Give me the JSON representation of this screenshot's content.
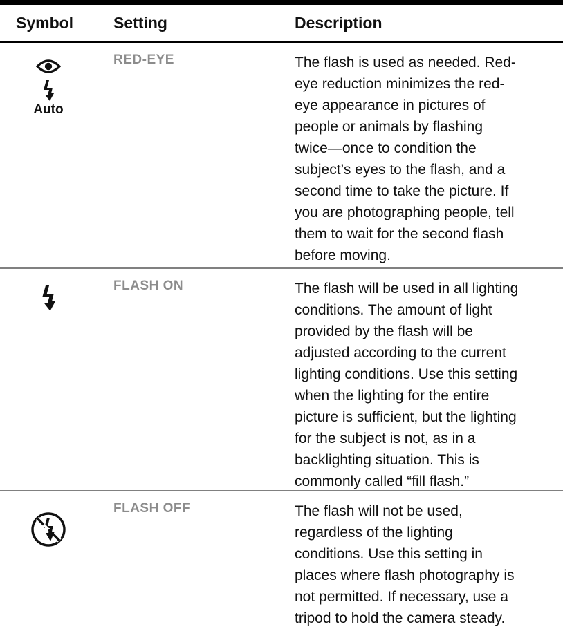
{
  "table": {
    "columns": [
      "Symbol",
      "Setting",
      "Description"
    ],
    "rows": [
      {
        "symbol_icons": [
          "eye-icon",
          "flash-icon"
        ],
        "symbol_label": "Auto",
        "setting": "RED-EYE",
        "description_lines": [
          "The flash is used as needed. Red-",
          "eye reduction minimizes the red-",
          "eye appearance in pictures of",
          "people or animals by flashing",
          "twice—once to condition the",
          "subject’s eyes to the flash, and a",
          "second time to take the picture. If",
          "you are photographing people, tell",
          "them to wait for the second flash",
          "before moving."
        ]
      },
      {
        "symbol_icons": [
          "flash-icon"
        ],
        "setting": "FLASH ON",
        "description_lines": [
          "The flash will be used in all lighting",
          "conditions. The amount of light",
          "provided by the flash will be",
          "adjusted according to the current",
          "lighting conditions. Use this setting",
          "when the lighting for the entire",
          "picture is sufficient, but the lighting",
          "for the subject is not, as in a",
          "backlighting situation. This is",
          "commonly called “fill flash.”"
        ]
      },
      {
        "symbol_icons": [
          "flash-off-icon"
        ],
        "setting": "FLASH OFF",
        "description_lines": [
          "The flash will not be used,",
          "regardless of the lighting",
          "conditions. Use this setting in",
          "places where flash photography is",
          "not permitted. If necessary, use a",
          "tripod to hold the camera steady."
        ]
      }
    ]
  },
  "colors": {
    "rule": "#000000",
    "row_divider": "#808080",
    "setting_text": "#8c8c8c",
    "body_text": "#111111"
  }
}
